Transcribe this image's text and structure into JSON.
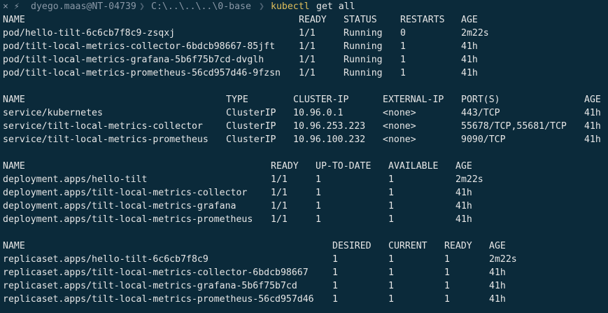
{
  "prompt": {
    "symbols": "× ⚡",
    "user_host": "dyego.maas@NT-04739",
    "path": "C:\\..\\..\\..\\0-base",
    "command": "kubectl",
    "args": "get all"
  },
  "pods": {
    "headers": [
      "NAME",
      "READY",
      "STATUS",
      "RESTARTS",
      "AGE"
    ],
    "rows": [
      [
        "pod/hello-tilt-6c6cb7f8c9-zsqxj",
        "1/1",
        "Running",
        "0",
        "2m22s"
      ],
      [
        "pod/tilt-local-metrics-collector-6bdcb98667-85jft",
        "1/1",
        "Running",
        "1",
        "41h"
      ],
      [
        "pod/tilt-local-metrics-grafana-5b6f75b7cd-dvglh",
        "1/1",
        "Running",
        "1",
        "41h"
      ],
      [
        "pod/tilt-local-metrics-prometheus-56cd957d46-9fzsn",
        "1/1",
        "Running",
        "1",
        "41h"
      ]
    ]
  },
  "services": {
    "headers": [
      "NAME",
      "TYPE",
      "CLUSTER-IP",
      "EXTERNAL-IP",
      "PORT(S)",
      "AGE"
    ],
    "rows": [
      [
        "service/kubernetes",
        "ClusterIP",
        "10.96.0.1",
        "<none>",
        "443/TCP",
        "41h"
      ],
      [
        "service/tilt-local-metrics-collector",
        "ClusterIP",
        "10.96.253.223",
        "<none>",
        "55678/TCP,55681/TCP",
        "41h"
      ],
      [
        "service/tilt-local-metrics-prometheus",
        "ClusterIP",
        "10.96.100.232",
        "<none>",
        "9090/TCP",
        "41h"
      ]
    ]
  },
  "deployments": {
    "headers": [
      "NAME",
      "READY",
      "UP-TO-DATE",
      "AVAILABLE",
      "AGE"
    ],
    "rows": [
      [
        "deployment.apps/hello-tilt",
        "1/1",
        "1",
        "1",
        "2m22s"
      ],
      [
        "deployment.apps/tilt-local-metrics-collector",
        "1/1",
        "1",
        "1",
        "41h"
      ],
      [
        "deployment.apps/tilt-local-metrics-grafana",
        "1/1",
        "1",
        "1",
        "41h"
      ],
      [
        "deployment.apps/tilt-local-metrics-prometheus",
        "1/1",
        "1",
        "1",
        "41h"
      ]
    ]
  },
  "replicasets": {
    "headers": [
      "NAME",
      "DESIRED",
      "CURRENT",
      "READY",
      "AGE"
    ],
    "rows": [
      [
        "replicaset.apps/hello-tilt-6c6cb7f8c9",
        "1",
        "1",
        "1",
        "2m22s"
      ],
      [
        "replicaset.apps/tilt-local-metrics-collector-6bdcb98667",
        "1",
        "1",
        "1",
        "41h"
      ],
      [
        "replicaset.apps/tilt-local-metrics-grafana-5b6f75b7cd",
        "1",
        "1",
        "1",
        "41h"
      ],
      [
        "replicaset.apps/tilt-local-metrics-prometheus-56cd957d46",
        "1",
        "1",
        "1",
        "41h"
      ]
    ]
  },
  "colors": {
    "background": "#0b2a3a",
    "text": "#e6e6e6",
    "prompt_muted": "#8a98a6",
    "command": "#e0bf5a"
  }
}
